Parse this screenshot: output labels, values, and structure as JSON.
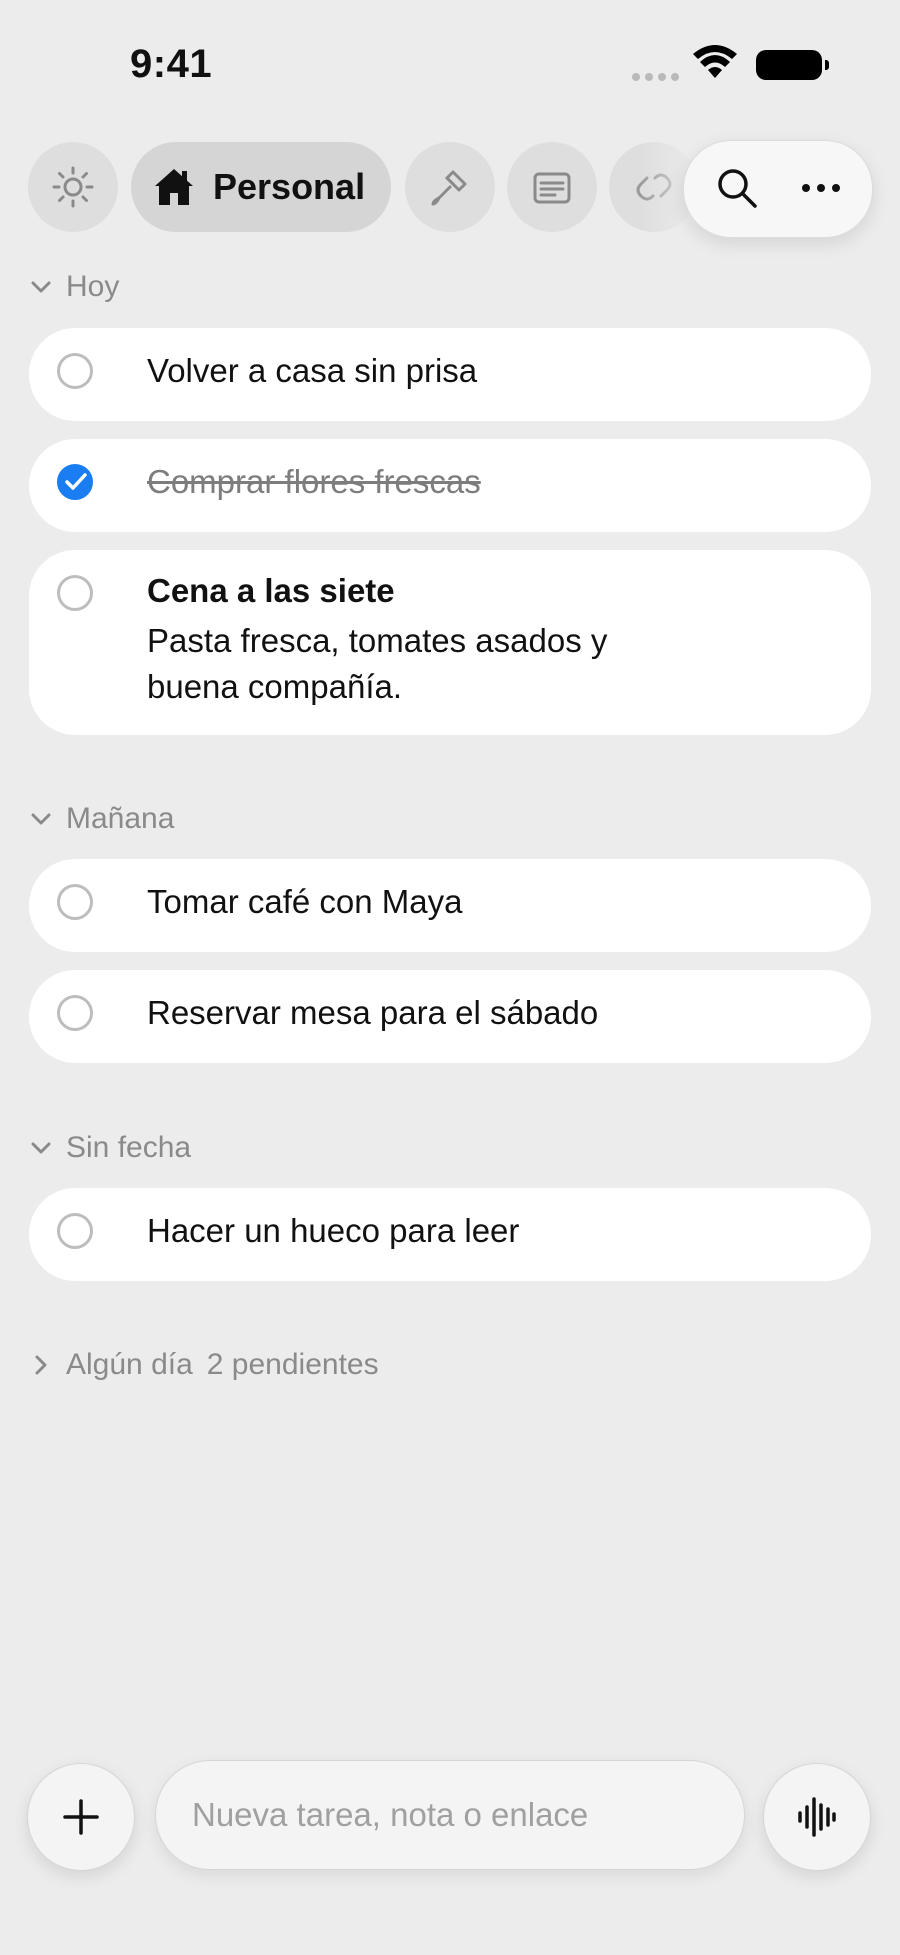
{
  "status_bar": {
    "time": "9:41"
  },
  "toolbar": {
    "active_list": "Personal",
    "lists": [
      "sun-icon",
      "home-icon",
      "paintbrush-icon",
      "notes-icon",
      "link-icon"
    ]
  },
  "sections": {
    "hoy": {
      "title": "Hoy",
      "tasks": [
        {
          "title": "Volver a casa sin prisa",
          "done": false
        },
        {
          "title": "Comprar flores frescas",
          "done": true
        },
        {
          "title": "Cena a las siete",
          "note": "Pasta fresca, tomates asados y buena compañía.",
          "done": false
        }
      ]
    },
    "manana": {
      "title": "Mañana",
      "tasks": [
        {
          "title": "Tomar café con Maya",
          "done": false
        },
        {
          "title": "Reservar mesa para el sábado",
          "done": false
        }
      ]
    },
    "sin_fecha": {
      "title": "Sin fecha",
      "tasks": [
        {
          "title": "Hacer un hueco para leer",
          "done": false
        }
      ]
    },
    "algun_dia": {
      "title": "Algún día",
      "count_label": "2 pendientes"
    }
  },
  "composer": {
    "placeholder": "Nueva tarea, nota o enlace"
  },
  "colors": {
    "accent": "#1a7ef2",
    "background": "#ececec",
    "card": "#ffffff",
    "muted": "#8a8a8a"
  }
}
